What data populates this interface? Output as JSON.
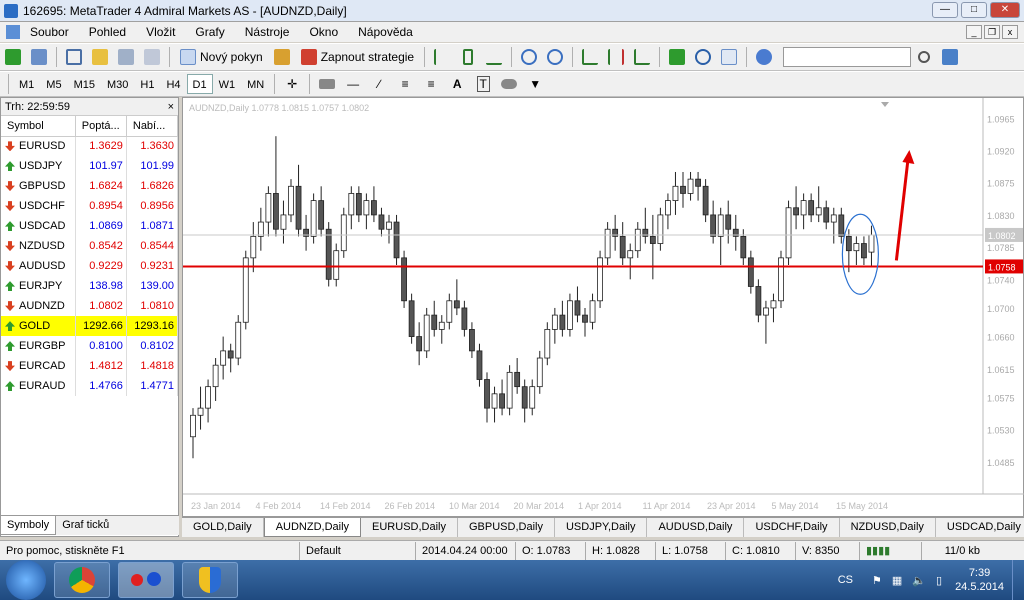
{
  "window": {
    "title": "162695: MetaTrader 4 Admiral Markets AS - [AUDNZD,Daily]"
  },
  "menu": [
    "Soubor",
    "Pohled",
    "Vložit",
    "Grafy",
    "Nástroje",
    "Okno",
    "Nápověda"
  ],
  "toolbar": {
    "new_order": "Nový pokyn",
    "strategies": "Zapnout strategie"
  },
  "timeframes": [
    "M1",
    "M5",
    "M15",
    "M30",
    "H1",
    "H4",
    "D1",
    "W1",
    "MN"
  ],
  "timeframe_selected": "D1",
  "market_watch": {
    "header": "Trh: 22:59:59",
    "columns": [
      "Symbol",
      "Poptá...",
      "Nabí..."
    ],
    "rows": [
      {
        "symbol": "EURUSD",
        "bid": "1.3629",
        "ask": "1.3630",
        "dir": "down",
        "color": "red"
      },
      {
        "symbol": "USDJPY",
        "bid": "101.97",
        "ask": "101.99",
        "dir": "up",
        "color": "blue"
      },
      {
        "symbol": "GBPUSD",
        "bid": "1.6824",
        "ask": "1.6826",
        "dir": "down",
        "color": "red"
      },
      {
        "symbol": "USDCHF",
        "bid": "0.8954",
        "ask": "0.8956",
        "dir": "down",
        "color": "red"
      },
      {
        "symbol": "USDCAD",
        "bid": "1.0869",
        "ask": "1.0871",
        "dir": "up",
        "color": "blue"
      },
      {
        "symbol": "NZDUSD",
        "bid": "0.8542",
        "ask": "0.8544",
        "dir": "down",
        "color": "red"
      },
      {
        "symbol": "AUDUSD",
        "bid": "0.9229",
        "ask": "0.9231",
        "dir": "down",
        "color": "red"
      },
      {
        "symbol": "EURJPY",
        "bid": "138.98",
        "ask": "139.00",
        "dir": "up",
        "color": "blue"
      },
      {
        "symbol": "AUDNZD",
        "bid": "1.0802",
        "ask": "1.0810",
        "dir": "down",
        "color": "red"
      },
      {
        "symbol": "GOLD",
        "bid": "1292.66",
        "ask": "1293.16",
        "dir": "up",
        "color": "black",
        "highlight": true
      },
      {
        "symbol": "EURGBP",
        "bid": "0.8100",
        "ask": "0.8102",
        "dir": "up",
        "color": "blue"
      },
      {
        "symbol": "EURCAD",
        "bid": "1.4812",
        "ask": "1.4818",
        "dir": "down",
        "color": "red"
      },
      {
        "symbol": "EURAUD",
        "bid": "1.4766",
        "ask": "1.4771",
        "dir": "up",
        "color": "blue"
      }
    ],
    "tabs": [
      "Symboly",
      "Graf ticků"
    ]
  },
  "chart_data": {
    "type": "candlestick",
    "title": "AUDNZD,Daily  1.0778 1.0815 1.0757 1.0802",
    "ylim": [
      1.044,
      1.0985
    ],
    "y_ticks": [
      "1.0965",
      "1.0920",
      "1.0875",
      "1.0830",
      "1.0785",
      "1.0740",
      "1.0700",
      "1.0660",
      "1.0615",
      "1.0575",
      "1.0530",
      "1.0485"
    ],
    "x_ticks": [
      "23 Jan 2014",
      "4 Feb 2014",
      "14 Feb 2014",
      "26 Feb 2014",
      "10 Mar 2014",
      "20 Mar 2014",
      "1 Apr 2014",
      "11 Apr 2014",
      "23 Apr 2014",
      "5 May 2014",
      "15 May 2014"
    ],
    "price_labels": {
      "current": "1.0802",
      "hline": "1.0758"
    },
    "hline_value": 1.0758,
    "candles": [
      [
        1.052,
        1.056,
        1.049,
        1.055
      ],
      [
        1.055,
        1.059,
        1.053,
        1.056
      ],
      [
        1.056,
        1.06,
        1.054,
        1.059
      ],
      [
        1.059,
        1.063,
        1.057,
        1.062
      ],
      [
        1.062,
        1.066,
        1.06,
        1.064
      ],
      [
        1.064,
        1.065,
        1.061,
        1.063
      ],
      [
        1.063,
        1.069,
        1.062,
        1.068
      ],
      [
        1.068,
        1.078,
        1.067,
        1.077
      ],
      [
        1.077,
        1.082,
        1.075,
        1.08
      ],
      [
        1.08,
        1.084,
        1.078,
        1.082
      ],
      [
        1.082,
        1.087,
        1.08,
        1.086
      ],
      [
        1.086,
        1.094,
        1.08,
        1.081
      ],
      [
        1.081,
        1.085,
        1.079,
        1.083
      ],
      [
        1.083,
        1.088,
        1.082,
        1.087
      ],
      [
        1.087,
        1.09,
        1.08,
        1.081
      ],
      [
        1.081,
        1.083,
        1.078,
        1.08
      ],
      [
        1.08,
        1.086,
        1.079,
        1.085
      ],
      [
        1.085,
        1.087,
        1.08,
        1.081
      ],
      [
        1.081,
        1.082,
        1.073,
        1.074
      ],
      [
        1.074,
        1.079,
        1.073,
        1.078
      ],
      [
        1.078,
        1.084,
        1.077,
        1.083
      ],
      [
        1.083,
        1.087,
        1.081,
        1.086
      ],
      [
        1.086,
        1.087,
        1.082,
        1.083
      ],
      [
        1.083,
        1.086,
        1.081,
        1.085
      ],
      [
        1.085,
        1.087,
        1.082,
        1.083
      ],
      [
        1.083,
        1.084,
        1.08,
        1.081
      ],
      [
        1.081,
        1.083,
        1.079,
        1.082
      ],
      [
        1.082,
        1.083,
        1.076,
        1.077
      ],
      [
        1.077,
        1.078,
        1.07,
        1.071
      ],
      [
        1.071,
        1.072,
        1.065,
        1.066
      ],
      [
        1.066,
        1.068,
        1.062,
        1.064
      ],
      [
        1.064,
        1.07,
        1.063,
        1.069
      ],
      [
        1.069,
        1.071,
        1.066,
        1.067
      ],
      [
        1.067,
        1.069,
        1.065,
        1.068
      ],
      [
        1.068,
        1.072,
        1.067,
        1.071
      ],
      [
        1.071,
        1.074,
        1.069,
        1.07
      ],
      [
        1.07,
        1.071,
        1.066,
        1.067
      ],
      [
        1.067,
        1.068,
        1.063,
        1.064
      ],
      [
        1.064,
        1.065,
        1.059,
        1.06
      ],
      [
        1.06,
        1.061,
        1.054,
        1.056
      ],
      [
        1.056,
        1.059,
        1.054,
        1.058
      ],
      [
        1.058,
        1.06,
        1.055,
        1.056
      ],
      [
        1.056,
        1.062,
        1.055,
        1.061
      ],
      [
        1.061,
        1.063,
        1.058,
        1.059
      ],
      [
        1.059,
        1.06,
        1.054,
        1.056
      ],
      [
        1.056,
        1.06,
        1.055,
        1.059
      ],
      [
        1.059,
        1.064,
        1.058,
        1.063
      ],
      [
        1.063,
        1.068,
        1.062,
        1.067
      ],
      [
        1.067,
        1.07,
        1.065,
        1.069
      ],
      [
        1.069,
        1.071,
        1.066,
        1.067
      ],
      [
        1.067,
        1.072,
        1.066,
        1.071
      ],
      [
        1.071,
        1.073,
        1.068,
        1.069
      ],
      [
        1.069,
        1.07,
        1.066,
        1.068
      ],
      [
        1.068,
        1.072,
        1.067,
        1.071
      ],
      [
        1.071,
        1.078,
        1.07,
        1.077
      ],
      [
        1.077,
        1.082,
        1.076,
        1.081
      ],
      [
        1.081,
        1.083,
        1.078,
        1.08
      ],
      [
        1.08,
        1.082,
        1.076,
        1.077
      ],
      [
        1.077,
        1.079,
        1.074,
        1.078
      ],
      [
        1.078,
        1.082,
        1.077,
        1.081
      ],
      [
        1.081,
        1.084,
        1.079,
        1.08
      ],
      [
        1.08,
        1.083,
        1.074,
        1.079
      ],
      [
        1.079,
        1.084,
        1.078,
        1.083
      ],
      [
        1.083,
        1.086,
        1.081,
        1.085
      ],
      [
        1.085,
        1.089,
        1.083,
        1.087
      ],
      [
        1.087,
        1.089,
        1.084,
        1.086
      ],
      [
        1.086,
        1.089,
        1.085,
        1.088
      ],
      [
        1.088,
        1.089,
        1.085,
        1.087
      ],
      [
        1.087,
        1.088,
        1.082,
        1.083
      ],
      [
        1.083,
        1.085,
        1.079,
        1.08
      ],
      [
        1.08,
        1.084,
        1.076,
        1.083
      ],
      [
        1.083,
        1.085,
        1.079,
        1.081
      ],
      [
        1.081,
        1.083,
        1.078,
        1.08
      ],
      [
        1.08,
        1.081,
        1.076,
        1.077
      ],
      [
        1.077,
        1.078,
        1.072,
        1.073
      ],
      [
        1.073,
        1.074,
        1.068,
        1.069
      ],
      [
        1.069,
        1.071,
        1.065,
        1.07
      ],
      [
        1.07,
        1.072,
        1.068,
        1.071
      ],
      [
        1.071,
        1.078,
        1.07,
        1.077
      ],
      [
        1.077,
        1.085,
        1.076,
        1.084
      ],
      [
        1.084,
        1.087,
        1.081,
        1.083
      ],
      [
        1.083,
        1.086,
        1.081,
        1.085
      ],
      [
        1.085,
        1.086,
        1.082,
        1.083
      ],
      [
        1.083,
        1.087,
        1.082,
        1.084
      ],
      [
        1.084,
        1.085,
        1.081,
        1.082
      ],
      [
        1.082,
        1.084,
        1.079,
        1.083
      ],
      [
        1.083,
        1.084,
        1.079,
        1.08
      ],
      [
        1.08,
        1.081,
        1.075,
        1.078
      ],
      [
        1.078,
        1.08,
        1.076,
        1.079
      ],
      [
        1.079,
        1.08,
        1.076,
        1.077
      ],
      [
        1.0778,
        1.0815,
        1.0757,
        1.0802
      ]
    ]
  },
  "chart_tabs": [
    "GOLD,Daily",
    "AUDNZD,Daily",
    "EURUSD,Daily",
    "GBPUSD,Daily",
    "USDJPY,Daily",
    "AUDUSD,Daily",
    "USDCHF,Daily",
    "NZDUSD,Daily",
    "USDCAD,Daily"
  ],
  "chart_tab_selected": "AUDNZD,Daily",
  "status": {
    "help": "Pro pomoc, stiskněte F1",
    "profile": "Default",
    "datetime": "2014.04.24 00:00",
    "open": "O: 1.0783",
    "high": "H: 1.0828",
    "low": "L: 1.0758",
    "close": "C: 1.0810",
    "volume": "V: 8350",
    "traffic": "11/0 kb"
  },
  "taskbar": {
    "lang": "CS",
    "time": "7:39",
    "date": "24.5.2014"
  }
}
